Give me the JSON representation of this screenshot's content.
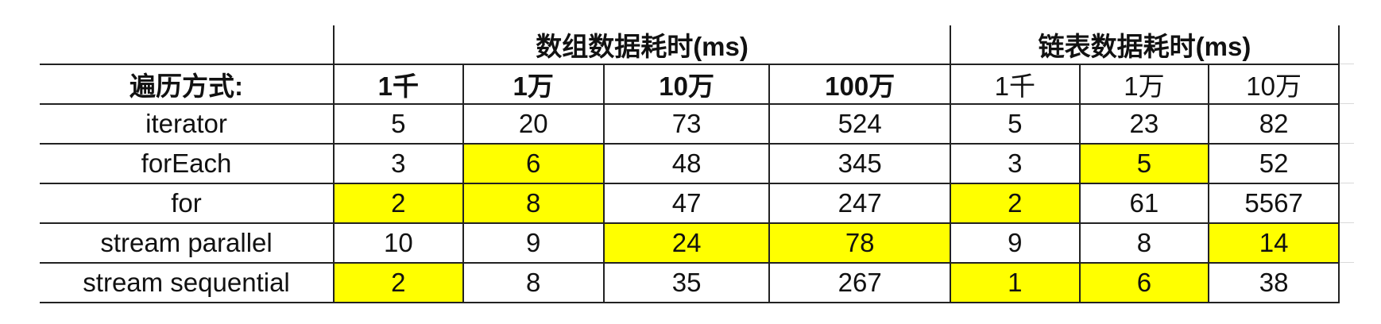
{
  "table": {
    "group_headers": {
      "array": "数组数据耗时(ms)",
      "linked": "链表数据耗时(ms)"
    },
    "row_label_header": "遍历方式:",
    "array_columns": [
      "1千",
      "1万",
      "10万",
      "100万"
    ],
    "linked_columns": [
      "1千",
      "1万",
      "10万"
    ],
    "rows": [
      {
        "label": "iterator",
        "array": [
          "5",
          "20",
          "73",
          "524"
        ],
        "linked": [
          "5",
          "23",
          "82"
        ]
      },
      {
        "label": "forEach",
        "array": [
          "3",
          "6",
          "48",
          "345"
        ],
        "linked": [
          "3",
          "5",
          "52"
        ]
      },
      {
        "label": "for",
        "array": [
          "2",
          "8",
          "47",
          "247"
        ],
        "linked": [
          "2",
          "61",
          "5567"
        ]
      },
      {
        "label": "stream parallel",
        "array": [
          "10",
          "9",
          "24",
          "78"
        ],
        "linked": [
          "9",
          "8",
          "14"
        ]
      },
      {
        "label": "stream sequential",
        "array": [
          "2",
          "8",
          "35",
          "267"
        ],
        "linked": [
          "1",
          "6",
          "38"
        ]
      }
    ],
    "highlight_color": "#ffff00"
  }
}
